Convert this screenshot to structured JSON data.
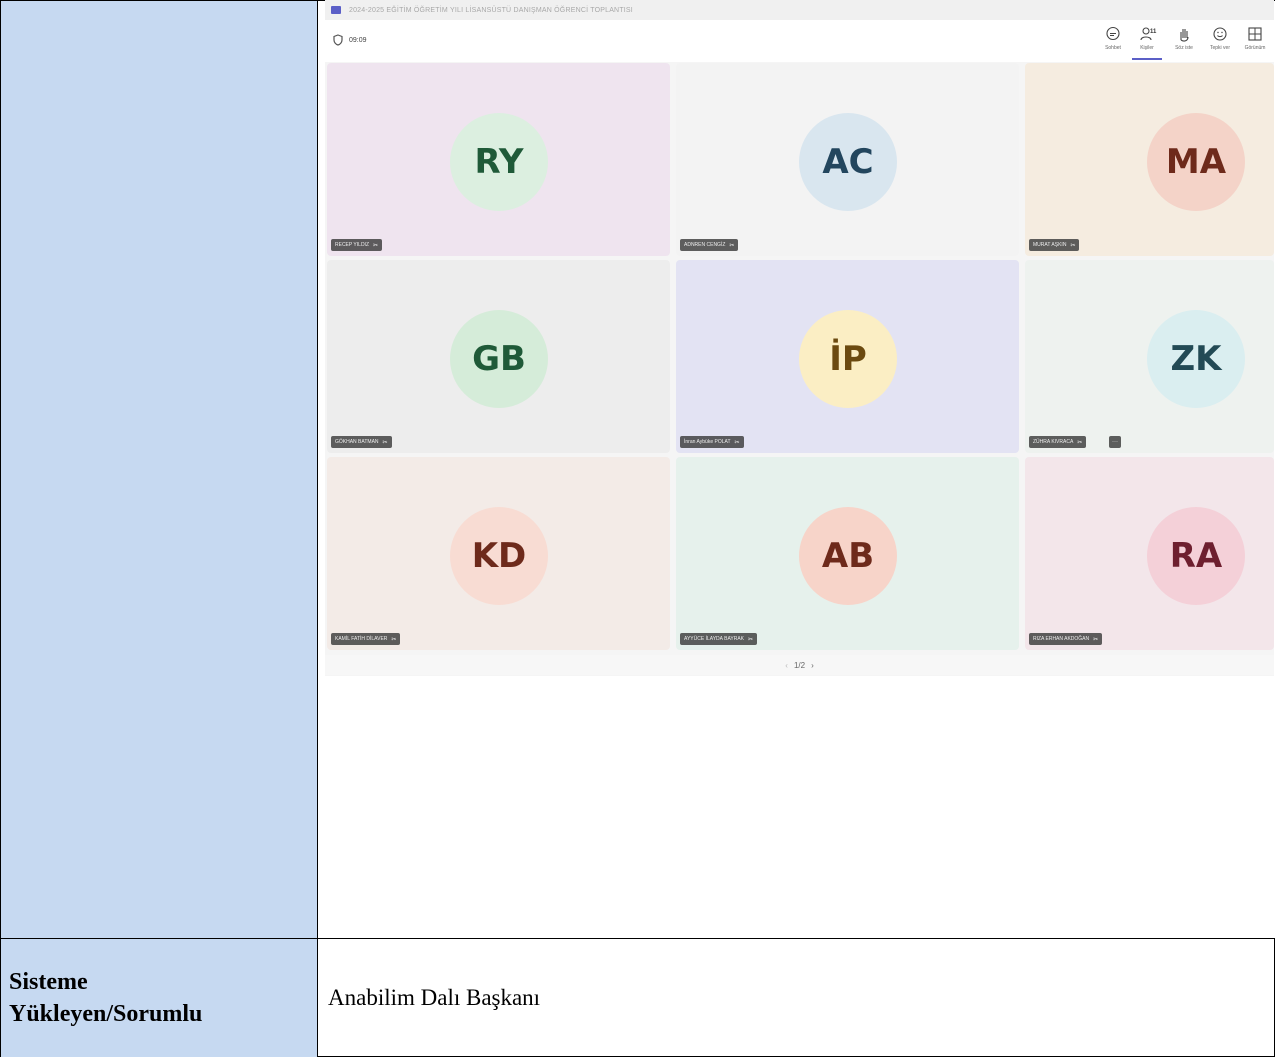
{
  "meeting": {
    "window_title": "2024-2025 EĞİTİM ÖĞRETİM YILI LİSANSÜSTÜ DANIŞMAN ÖĞRENCİ TOPLANTISI",
    "timer": "09:09",
    "toolbar": [
      {
        "icon": "chat-icon",
        "label": "Sohbet"
      },
      {
        "icon": "people-icon",
        "label": "Kişiler",
        "count": "11"
      },
      {
        "icon": "raise-hand-icon",
        "label": "Söz iste"
      },
      {
        "icon": "react-icon",
        "label": "Tepki ver"
      },
      {
        "icon": "view-icon",
        "label": "Görünüm"
      }
    ],
    "participants": [
      {
        "initials": "RY",
        "name": "RECEP YILDIZ",
        "avatar_bg": "#dcefe0",
        "avatar_fg": "#1f5a38",
        "tile_bg": "#efe4ef"
      },
      {
        "initials": "AC",
        "name": "ADNREN CENGİZ",
        "avatar_bg": "#d9e6ef",
        "avatar_fg": "#23465e",
        "tile_bg": "#f3f3f3"
      },
      {
        "initials": "MA",
        "name": "MURAT AŞKIN",
        "avatar_bg": "#f4d3c8",
        "avatar_fg": "#6e2a1b",
        "tile_bg": "#f5ece0"
      },
      {
        "initials": "GB",
        "name": "GÖKHAN BATMAN",
        "avatar_bg": "#d5ecd9",
        "avatar_fg": "#1f5a38",
        "tile_bg": "#ededed"
      },
      {
        "initials": "İP",
        "name": "İnran Aybüke POLAT",
        "avatar_bg": "#fbeec4",
        "avatar_fg": "#6b4a10",
        "tile_bg": "#e3e3f3"
      },
      {
        "initials": "ZK",
        "name": "ZÜHRA KIVRACA",
        "avatar_bg": "#daeef0",
        "avatar_fg": "#234a55",
        "tile_bg": "#eef2ef",
        "more": "···"
      },
      {
        "initials": "KD",
        "name": "KAMİL FATİH DİLAVER",
        "avatar_bg": "#f8dcd3",
        "avatar_fg": "#6e2a1b",
        "tile_bg": "#f3ebe7"
      },
      {
        "initials": "AB",
        "name": "AYYÜCE İLAYDA BAYRAK",
        "avatar_bg": "#f7d4c9",
        "avatar_fg": "#6e2a1b",
        "tile_bg": "#e6f1ec"
      },
      {
        "initials": "RA",
        "name": "RIZA ERHAN AKDOĞAN",
        "avatar_bg": "#f4d0d8",
        "avatar_fg": "#6e1f2f",
        "tile_bg": "#f3e6ea"
      }
    ],
    "pager": {
      "prev": "‹",
      "label": "1/2",
      "next": "›"
    }
  },
  "doc": {
    "label": "Sisteme Yükleyen/Sorumlu",
    "label_line1": "Sisteme",
    "label_line2": "Yükleyen/Sorumlu",
    "value": "Anabilim Dalı Başkanı"
  }
}
